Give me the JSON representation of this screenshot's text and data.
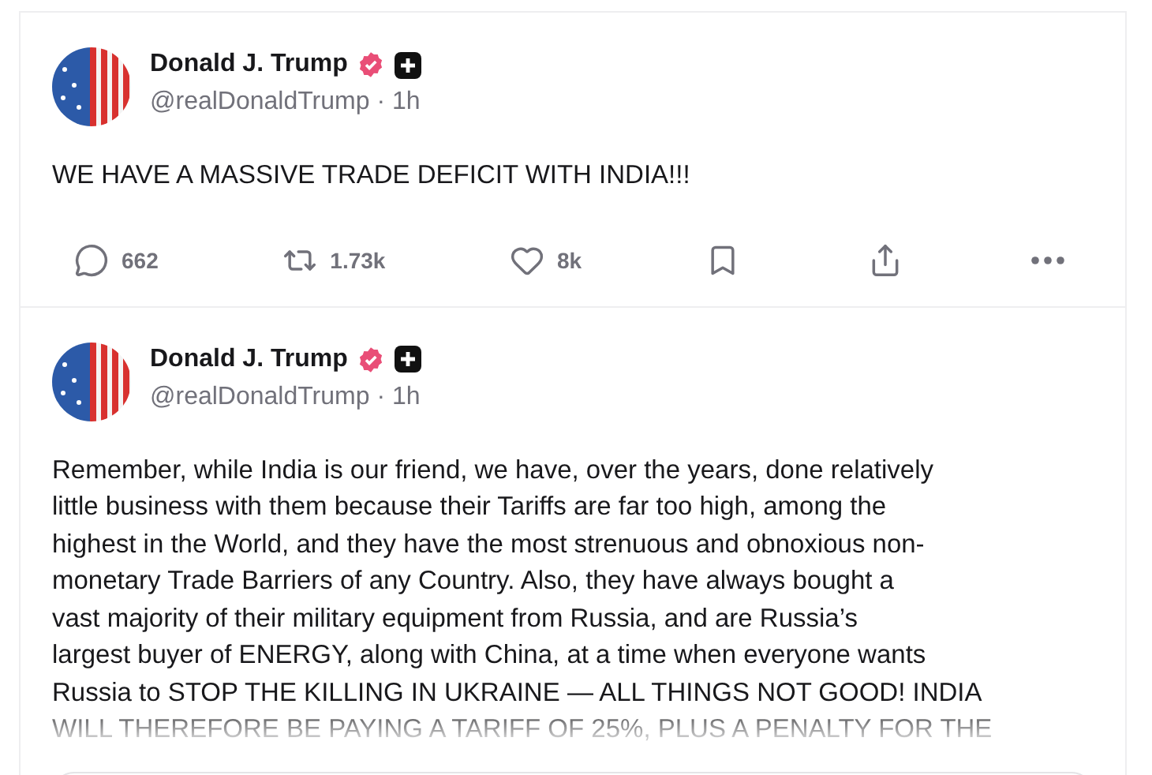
{
  "posts": [
    {
      "author": {
        "name": "Donald J. Trump",
        "verified": true,
        "handle": "@realDonaldTrump",
        "separator": "·",
        "time": "1h"
      },
      "text": "WE HAVE A MASSIVE TRADE DEFICIT WITH INDIA!!!",
      "faded_end": false,
      "actions": [
        {
          "kind": "reply",
          "count": "662"
        },
        {
          "kind": "repost",
          "count": "1.73k"
        },
        {
          "kind": "like",
          "count": "8k"
        },
        {
          "kind": "bookmark"
        },
        {
          "kind": "share"
        },
        {
          "kind": "more"
        }
      ]
    },
    {
      "author": {
        "name": "Donald J. Trump",
        "verified": true,
        "handle": "@realDonaldTrump",
        "separator": "·",
        "time": "1h"
      },
      "text": "Remember, while India is our friend, we have, over the years, done relatively\nlittle business with them because their Tariffs are far too high, among the\nhighest in the World, and they have the most strenuous and obnoxious non-\nmonetary Trade Barriers of any Country. Also, they have always bought a\nvast majority of their military equipment from Russia, and are Russia’s\nlargest buyer of ENERGY, along with China, at a time when everyone wants\nRussia to STOP THE KILLING IN UKRAINE — ALL THINGS NOT GOOD! INDIA\nWILL THEREFORE BE PAYING A TARIFF OF 25%, PLUS A PENALTY FOR THE",
      "faded_end": true,
      "embed": true
    }
  ]
}
